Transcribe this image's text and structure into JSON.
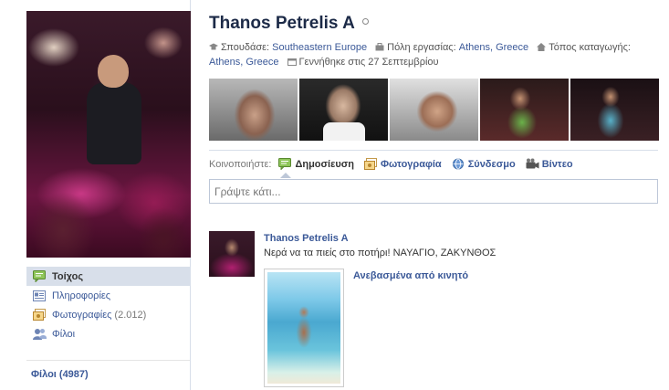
{
  "profile": {
    "name": "Thanos Petrelis A",
    "info": {
      "studies_label": "Σπουδάσε:",
      "studies_value": "Southeastern Europe",
      "work_city_label": "Πόλη εργασίας:",
      "work_city_value": "Athens, Greece",
      "hometown_label": "Τόπος καταγωγής:",
      "hometown_value": "Athens, Greece",
      "birthday": "Γεννήθηκε στις 27 Σεπτεμβρίου"
    }
  },
  "sidebar": {
    "items": [
      {
        "label": "Τοίχος",
        "icon": "wall-icon",
        "active": true
      },
      {
        "label": "Πληροφορίες",
        "icon": "info-icon",
        "active": false
      },
      {
        "label": "Φωτογραφίες",
        "count": "(2.012)",
        "icon": "photos-icon",
        "active": false
      },
      {
        "label": "Φίλοι",
        "icon": "friends-icon",
        "active": false
      }
    ],
    "friends_link": "Φίλοι (4987)"
  },
  "share": {
    "label": "Κοινοποιήστε:",
    "options": [
      {
        "label": "Δημοσίευση",
        "icon": "status-icon"
      },
      {
        "label": "Φωτογραφία",
        "icon": "photo-icon"
      },
      {
        "label": "Σύνδεσμο",
        "icon": "link-icon"
      },
      {
        "label": "Βίντεο",
        "icon": "video-icon"
      }
    ],
    "composer_placeholder": "Γράψτε κάτι..."
  },
  "post": {
    "author": "Thanos Petrelis A",
    "text": "Νερά να τα πιείς στο ποτήρι! ΝΑΥΑΓΙΟ, ΖΑΚΥΝΘΟΣ",
    "upload_link": "Ανεβασμένα από κινητό"
  },
  "colors": {
    "link": "#3b5998",
    "title": "#1c2a47",
    "active_nav_bg": "#d8dfea",
    "border": "#bdc7d8"
  }
}
